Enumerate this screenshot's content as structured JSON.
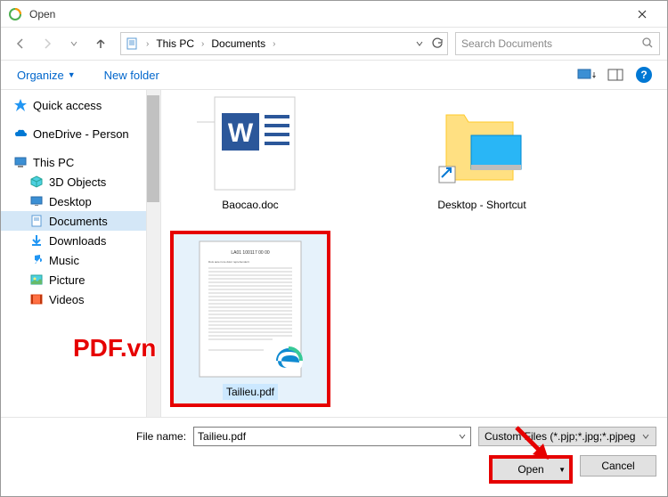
{
  "title": "Open",
  "breadcrumb": {
    "root": "This PC",
    "folder": "Documents"
  },
  "search_placeholder": "Search Documents",
  "toolbar": {
    "organize": "Organize",
    "new_folder": "New folder"
  },
  "sidebar": {
    "quick_access": "Quick access",
    "onedrive": "OneDrive - Person",
    "this_pc": "This PC",
    "items": [
      {
        "label": "3D Objects"
      },
      {
        "label": "Desktop"
      },
      {
        "label": "Documents"
      },
      {
        "label": "Downloads"
      },
      {
        "label": "Music"
      },
      {
        "label": "Picture"
      },
      {
        "label": "Videos"
      }
    ]
  },
  "files": {
    "baocao": "Baocao.doc",
    "desktop_shortcut": "Desktop - Shortcut",
    "tailieu": "Tailieu.pdf"
  },
  "filename_label": "File name:",
  "filename_value": "Tailieu.pdf",
  "filter": "Custom Files (*.pjp;*.jpg;*.pjpeg",
  "open_btn": "Open",
  "cancel_btn": "Cancel",
  "watermark": "PDF.vn"
}
